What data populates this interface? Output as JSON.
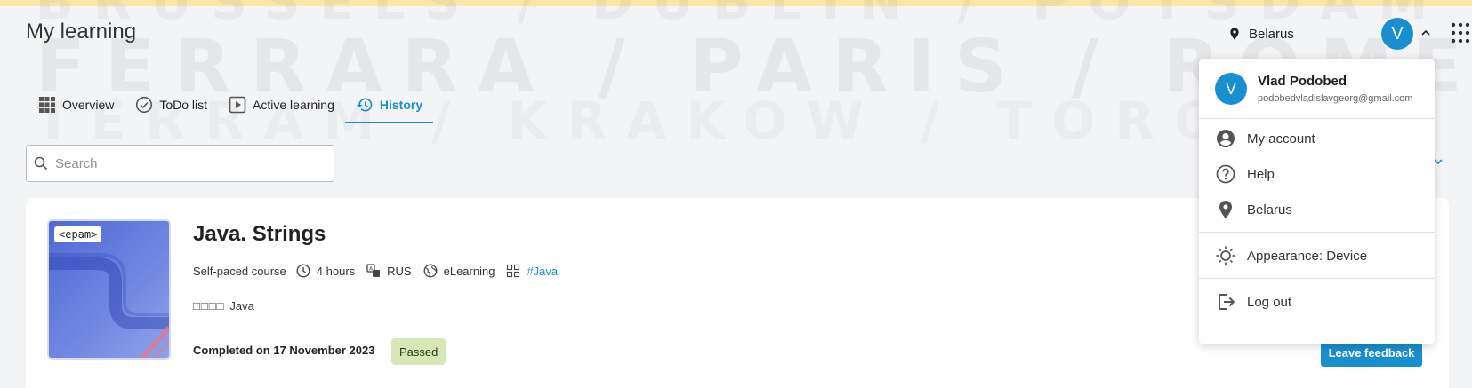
{
  "background_text": {
    "rows": [
      "BRUSSELS / DUBLIN / POTSDAM",
      "FERRARA / PARIS / ROME / OSLO / FLORENCE",
      "TERRAM / KRAKOW / TORONTO"
    ]
  },
  "header": {
    "title": "My learning",
    "country": "Belarus",
    "avatar_initial": "V"
  },
  "tabs": [
    {
      "label": "Overview",
      "icon": "grid-icon",
      "active": false
    },
    {
      "label": "ToDo list",
      "icon": "check-circle-icon",
      "active": false
    },
    {
      "label": "Active learning",
      "icon": "play-square-icon",
      "active": false
    },
    {
      "label": "History",
      "icon": "history-icon",
      "active": true
    }
  ],
  "search": {
    "placeholder": "Search",
    "value": ""
  },
  "course": {
    "logo_text": "<epam>",
    "title": "Java. Strings",
    "type": "Self-paced course",
    "duration": "4 hours",
    "language": "RUS",
    "format": "eLearning",
    "tag": "#Java",
    "skill_boxes": "□□□□",
    "skill": "Java",
    "completed": "Completed on 17 November 2023",
    "status": "Passed",
    "feedback_button": "Leave feedback"
  },
  "user_menu": {
    "avatar_initial": "V",
    "name": "Vlad Podobed",
    "email": "podobedvladislavgeorg@gmail.com",
    "items": [
      {
        "label": "My account",
        "icon": "account-circle-icon"
      },
      {
        "label": "Help",
        "icon": "help-circle-icon"
      },
      {
        "label": "Belarus",
        "icon": "location-pin-icon"
      },
      {
        "label": "Appearance: Device",
        "icon": "brightness-icon"
      },
      {
        "label": "Log out",
        "icon": "logout-icon"
      }
    ]
  },
  "colors": {
    "accent": "#1a8fd0",
    "top_stripe": "#f9e7a6",
    "passed_badge": "#d5e8b6",
    "page_background": "#f3f4f6"
  }
}
